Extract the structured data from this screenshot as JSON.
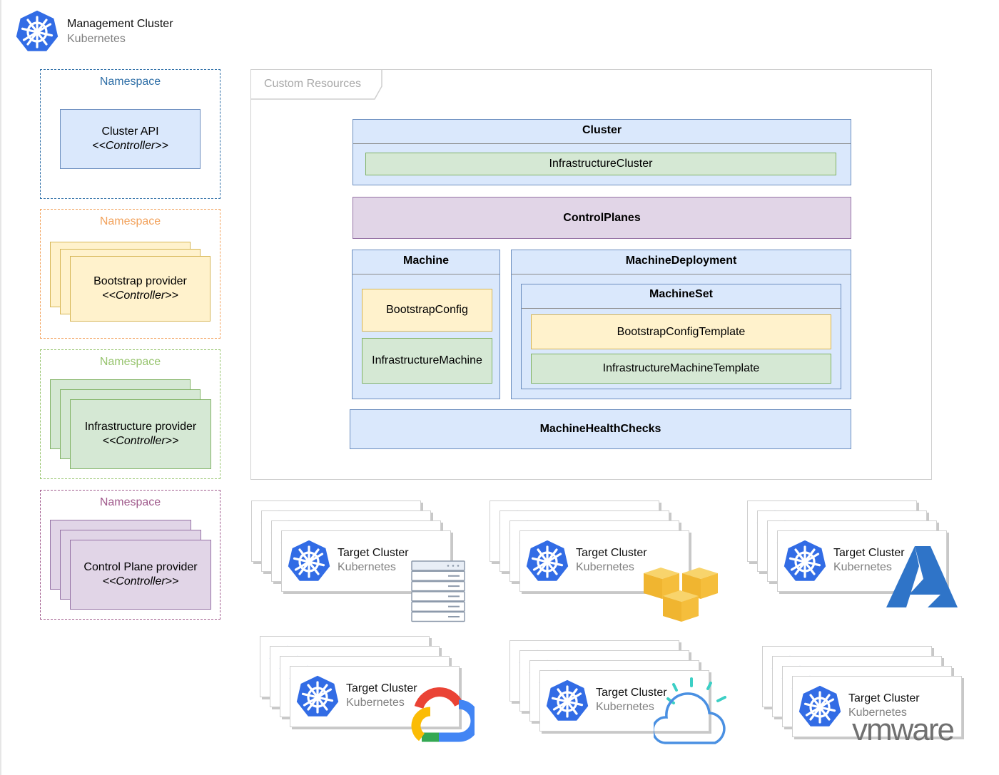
{
  "header": {
    "title": "Management Cluster",
    "subtitle": "Kubernetes",
    "icon": "kubernetes-helm-icon"
  },
  "colors": {
    "k8s_blue": "#326ce5",
    "ns_blue": "#2f6fa7",
    "ns_orange": "#f2a25c",
    "ns_green": "#97c46e",
    "ns_purple": "#a05a8c",
    "fill_blue": "#dae8fc",
    "fill_green": "#d5e8d4",
    "fill_yellow": "#fff2cc",
    "fill_purple": "#e1d5e7"
  },
  "namespaces": [
    {
      "label": "Namespace",
      "title": "Cluster API",
      "stereotype": "<<Controller>>"
    },
    {
      "label": "Namespace",
      "title": "Bootstrap provider",
      "stereotype": "<<Controller>>"
    },
    {
      "label": "Namespace",
      "title": "Infrastructure provider",
      "stereotype": "<<Controller>>"
    },
    {
      "label": "Namespace",
      "title": "Control Plane provider",
      "stereotype": "<<Controller>>"
    }
  ],
  "custom_resources": {
    "label": "Custom Resources",
    "cluster": {
      "title": "Cluster",
      "child": "InfrastructureCluster"
    },
    "control_planes": "ControlPlanes",
    "machine": {
      "title": "Machine",
      "children": [
        "BootstrapConfig",
        "InfrastructureMachine"
      ]
    },
    "machine_deployment": {
      "title": "MachineDeployment",
      "machine_set": {
        "title": "MachineSet",
        "children": [
          "BootstrapConfigTemplate",
          "InfrastructureMachineTemplate"
        ]
      }
    },
    "health_checks": "MachineHealthChecks"
  },
  "target_clusters": [
    {
      "title": "Target Cluster",
      "subtitle": "Kubernetes",
      "provider": "bare-metal-server"
    },
    {
      "title": "Target Cluster",
      "subtitle": "Kubernetes",
      "provider": "aws"
    },
    {
      "title": "Target Cluster",
      "subtitle": "Kubernetes",
      "provider": "azure"
    },
    {
      "title": "Target Cluster",
      "subtitle": "Kubernetes",
      "provider": "google-cloud"
    },
    {
      "title": "Target Cluster",
      "subtitle": "Kubernetes",
      "provider": "ibm-cloud"
    },
    {
      "title": "Target Cluster",
      "subtitle": "Kubernetes",
      "provider": "vmware",
      "provider_text": "vmware"
    }
  ]
}
